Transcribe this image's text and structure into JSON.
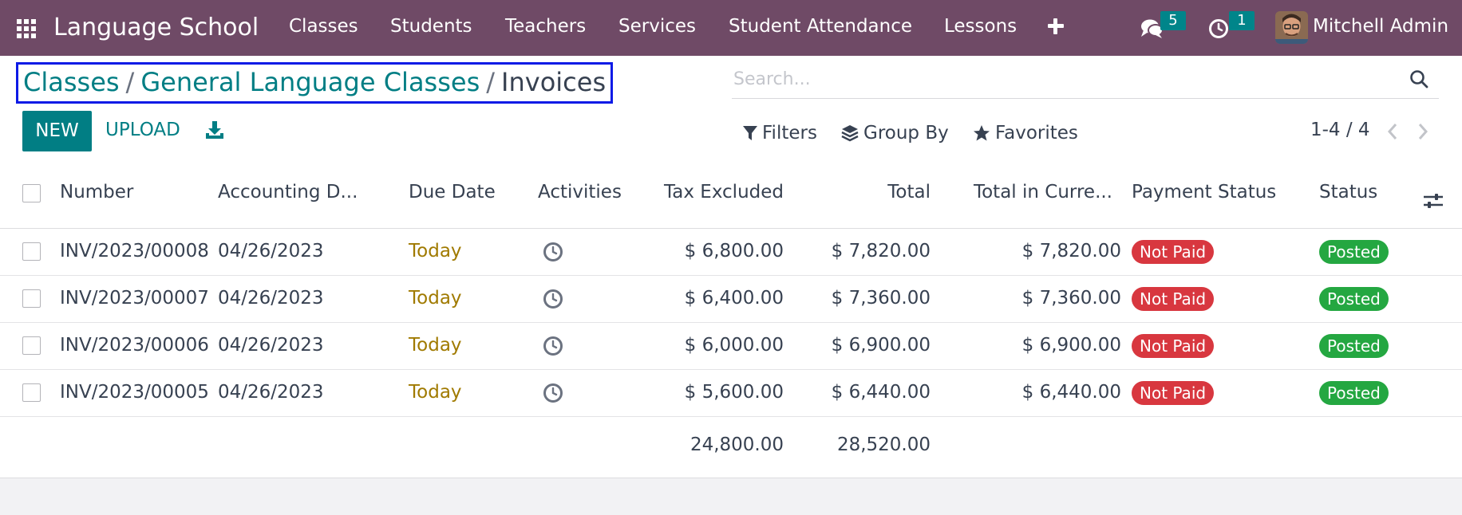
{
  "navbar": {
    "app_name": "Language School",
    "menu": [
      "Classes",
      "Students",
      "Teachers",
      "Services",
      "Student Attendance",
      "Lessons"
    ],
    "messages_count": "5",
    "activities_count": "1",
    "user_name": "Mitchell Admin",
    "colors": {
      "background": "#6f4a66",
      "badge": "#00858a"
    }
  },
  "breadcrumb": {
    "items": [
      "Classes",
      "General Language Classes"
    ],
    "current": "Invoices",
    "separator": "/"
  },
  "actions": {
    "new_label": "NEW",
    "upload_label": "UPLOAD"
  },
  "search": {
    "placeholder": "Search..."
  },
  "filters": {
    "filters_label": "Filters",
    "group_by_label": "Group By",
    "favorites_label": "Favorites"
  },
  "pager": {
    "value": "1-4 / 4"
  },
  "table": {
    "columns": [
      "Number",
      "Accounting D...",
      "Due Date",
      "Activities",
      "Tax Excluded",
      "Total",
      "Total in Curre...",
      "Payment Status",
      "Status"
    ],
    "rows": [
      {
        "number": "INV/2023/00008",
        "accounting_date": "04/26/2023",
        "due_date": "Today",
        "tax_excluded": "$ 6,800.00",
        "total": "$ 7,820.00",
        "total_currency": "$ 7,820.00",
        "payment_status": "Not Paid",
        "status": "Posted"
      },
      {
        "number": "INV/2023/00007",
        "accounting_date": "04/26/2023",
        "due_date": "Today",
        "tax_excluded": "$ 6,400.00",
        "total": "$ 7,360.00",
        "total_currency": "$ 7,360.00",
        "payment_status": "Not Paid",
        "status": "Posted"
      },
      {
        "number": "INV/2023/00006",
        "accounting_date": "04/26/2023",
        "due_date": "Today",
        "tax_excluded": "$ 6,000.00",
        "total": "$ 6,900.00",
        "total_currency": "$ 6,900.00",
        "payment_status": "Not Paid",
        "status": "Posted"
      },
      {
        "number": "INV/2023/00005",
        "accounting_date": "04/26/2023",
        "due_date": "Today",
        "tax_excluded": "$ 5,600.00",
        "total": "$ 6,440.00",
        "total_currency": "$ 6,440.00",
        "payment_status": "Not Paid",
        "status": "Posted"
      }
    ],
    "totals": {
      "tax_excluded": "24,800.00",
      "total": "28,520.00"
    },
    "colors": {
      "not_paid": "#d8373f",
      "posted": "#24a741",
      "due_today": "#a07a00",
      "primary": "#017e84"
    }
  }
}
